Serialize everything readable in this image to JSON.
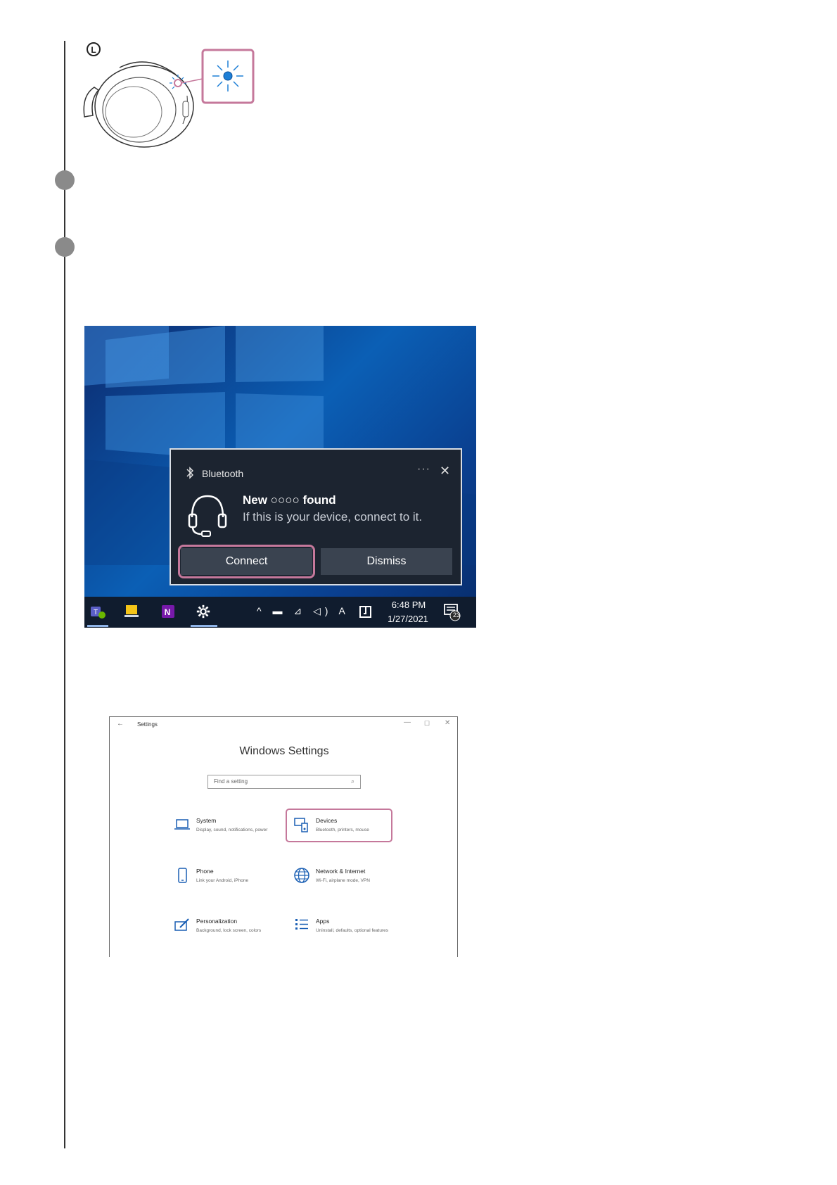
{
  "headphone": {
    "side_label": "L",
    "indicator_color": "#1e7fd6",
    "callout_border_color": "#c5789b"
  },
  "desktop": {
    "toast": {
      "app_name": "Bluetooth",
      "more_glyph": "···",
      "close_glyph": "✕",
      "title": "New ○○○○ found",
      "body": "If this is your device, connect to it.",
      "connect_label": "Connect",
      "dismiss_label": "Dismiss"
    },
    "taskbar": {
      "tray_icons": "^ ▬ ⊿ ◁) A",
      "time": "6:48 PM",
      "date": "1/27/2021",
      "notification_count": "23"
    }
  },
  "settings": {
    "window_title": "Settings",
    "back_glyph": "←",
    "minimize_glyph": "—",
    "maximize_glyph": "☐",
    "close_glyph": "✕",
    "heading": "Windows Settings",
    "search_placeholder": "Find a setting",
    "items": [
      {
        "title": "System",
        "desc": "Display, sound, notifications, power",
        "icon": "laptop-icon"
      },
      {
        "title": "Devices",
        "desc": "Bluetooth, printers, mouse",
        "icon": "devices-icon"
      },
      {
        "title": "Phone",
        "desc": "Link your Android, iPhone",
        "icon": "phone-icon"
      },
      {
        "title": "Network & Internet",
        "desc": "Wi-Fi, airplane mode, VPN",
        "icon": "globe-icon"
      },
      {
        "title": "Personalization",
        "desc": "Background, lock screen, colors",
        "icon": "personalization-icon"
      },
      {
        "title": "Apps",
        "desc": "Uninstall, defaults, optional features",
        "icon": "apps-icon"
      }
    ]
  }
}
